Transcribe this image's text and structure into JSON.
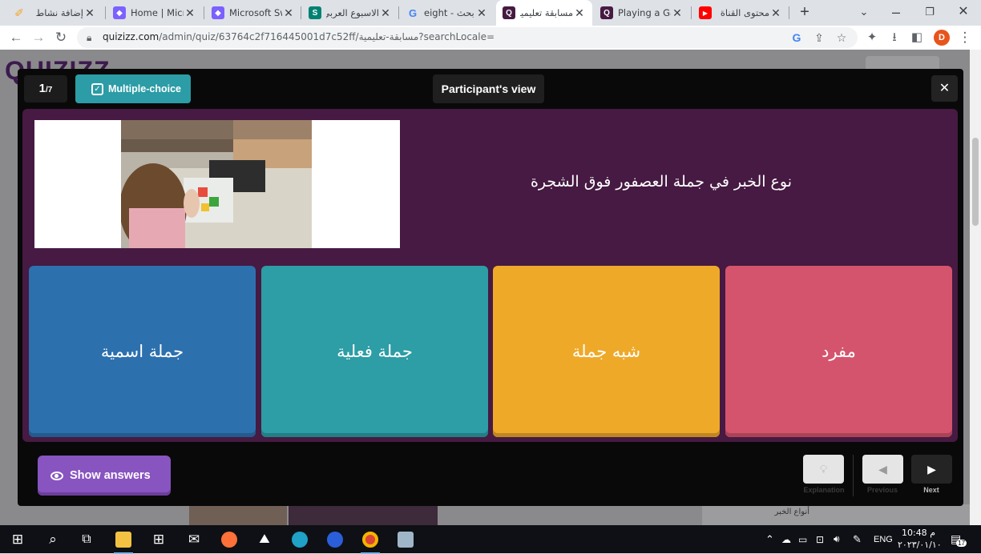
{
  "browser": {
    "tabs": [
      {
        "title": "إضافة نشاط",
        "favicon": "#f5a623",
        "favicon_glyph": "✐"
      },
      {
        "title": "Home | Micro",
        "favicon": "#7b61ff",
        "favicon_glyph": "◆"
      },
      {
        "title": "Microsoft Sw",
        "favicon": "#7b61ff",
        "favicon_glyph": "◆"
      },
      {
        "title": "الاسبوع العربي",
        "favicon": "#008272",
        "favicon_glyph": "S"
      },
      {
        "title": "eight - بحث G",
        "favicon": "#ffffff",
        "favicon_glyph": "G"
      },
      {
        "title": "مسابقة تعليمية",
        "favicon": "#461a42",
        "favicon_glyph": "Q",
        "active": true
      },
      {
        "title": "Playing a Gam",
        "favicon": "#461a42",
        "favicon_glyph": "Q"
      },
      {
        "title": "محتوى القناة",
        "favicon": "#ff0000",
        "favicon_glyph": "▶"
      }
    ],
    "url_host": "quizizz.com",
    "url_path": "/admin/quiz/63764c2f716445001d7c52ff/مسابقة-تعليمية?searchLocale=",
    "profile_initial": "D"
  },
  "page": {
    "logo_text": "QUIZIZZ"
  },
  "modal": {
    "question_index": "1",
    "question_total": "/7",
    "question_type": "Multiple-choice",
    "view_label": "Participant's view",
    "close_label": "✕",
    "question_text": "نوع الخبر في جملة العصفور فوق الشجرة",
    "options": [
      {
        "label": "جملة اسمية",
        "color": "#2d70ae"
      },
      {
        "label": "جملة فعلية",
        "color": "#2d9da6"
      },
      {
        "label": "شبه جملة",
        "color": "#efa929"
      },
      {
        "label": "مفرد",
        "color": "#d5546d"
      }
    ],
    "show_answers_label": "Show answers",
    "controls": {
      "explanation_label": "Explanation",
      "previous_label": "Previous",
      "next_label": "Next"
    }
  },
  "taskbar": {
    "language": "ENG",
    "time": "10:48 م",
    "date": "٢٠٢٣/٠١/١٠",
    "notification_badge": "17"
  },
  "behind_modal": {
    "snippet": "أنواع الخبر"
  }
}
